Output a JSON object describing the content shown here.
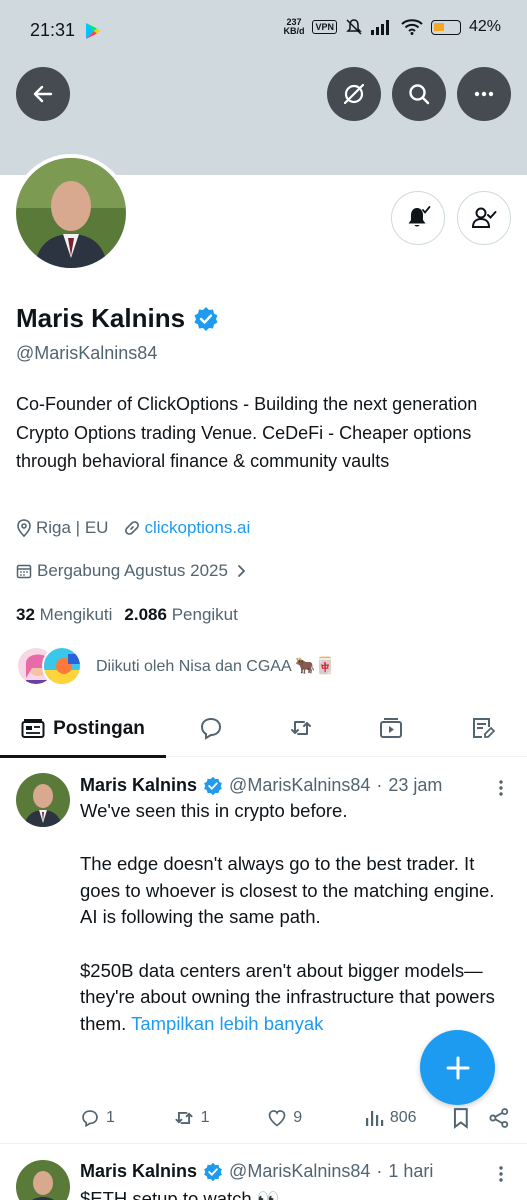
{
  "status_bar": {
    "time": "21:31",
    "network_speed_top": "237",
    "network_speed_bottom": "KB/d",
    "vpn": "VPN",
    "battery": "42%",
    "battery_level": 0.42
  },
  "profile": {
    "display_name": "Maris Kalnins",
    "handle": "@MarisKalnins84",
    "bio": "Co-Founder of ClickOptions -  Building the next generation Crypto Options trading Venue.  CeDeFi - Cheaper options through behavioral finance & community vaults",
    "location": "Riga | EU",
    "website": "clickoptions.ai",
    "joined": "Bergabung Agustus 2025",
    "following_count": "32",
    "following_label": "Mengikuti",
    "followers_count": "2.086",
    "followers_label": "Pengikut",
    "followed_by": "Diikuti oleh Nisa dan CGAA 🐂🀄"
  },
  "tabs": {
    "active_label": "Postingan"
  },
  "posts": [
    {
      "name": "Maris Kalnins",
      "handle": "@MarisKalnins84",
      "time": "23 jam",
      "body_main": "We've seen this in crypto before.\n\nThe edge doesn't always go to the best trader. It goes to whoever is closest to the matching engine.\nAI is following the same path.\n\n$250B data centers aren't about bigger models—they're about owning the infrastructure that powers them. ",
      "show_more": "Tampilkan lebih banyak",
      "replies": "1",
      "reposts": "1",
      "likes": "9",
      "views": "806"
    },
    {
      "name": "Maris Kalnins",
      "handle": "@MarisKalnins84",
      "time": "1 hari",
      "body_main": "$ETH setup to watch 👀"
    }
  ],
  "colors": {
    "accent": "#1d9bf0",
    "banner": "#cfd9de",
    "text_secondary": "#536471"
  }
}
